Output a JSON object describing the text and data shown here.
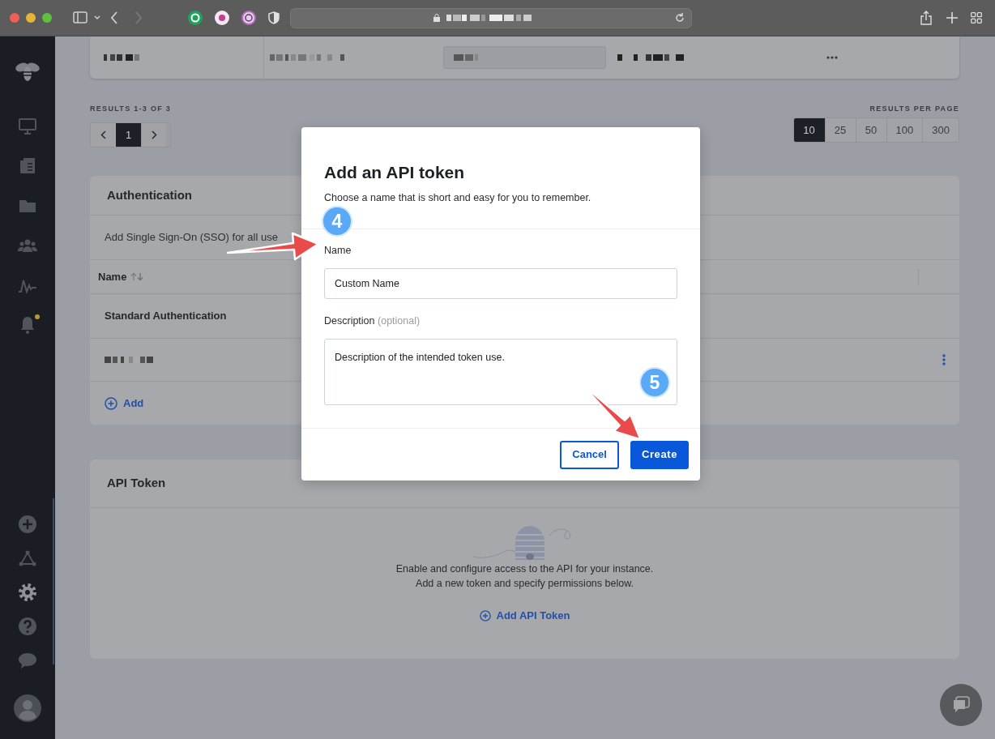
{
  "sidebar": {
    "items": [
      {
        "kind": "monitor",
        "selected": false,
        "notification": false
      },
      {
        "kind": "book",
        "selected": false,
        "notification": false
      },
      {
        "kind": "folder",
        "selected": false,
        "notification": false
      },
      {
        "kind": "users",
        "selected": false,
        "notification": false
      },
      {
        "kind": "pulse",
        "selected": false,
        "notification": false
      },
      {
        "kind": "bell",
        "selected": false,
        "notification": true
      }
    ],
    "bottom_items": [
      {
        "kind": "plus",
        "selected": false
      },
      {
        "kind": "network",
        "selected": false
      },
      {
        "kind": "gear",
        "selected": true
      },
      {
        "kind": "help",
        "selected": false
      },
      {
        "kind": "chat",
        "selected": false
      }
    ]
  },
  "pagination": {
    "results_label": "RESULTS 1-3 OF 3",
    "pages": [
      {
        "label": "1",
        "selected": true
      }
    ],
    "per_page_label": "RESULTS PER PAGE",
    "per_page_options": [
      {
        "label": "10",
        "selected": true
      },
      {
        "label": "25",
        "selected": false
      },
      {
        "label": "50",
        "selected": false
      },
      {
        "label": "100",
        "selected": false
      },
      {
        "label": "300",
        "selected": false
      }
    ]
  },
  "authentication": {
    "title": "Authentication",
    "description": "Add Single Sign-On (SSO) for all use",
    "columns": [
      {
        "label": "Name"
      }
    ],
    "rows": [
      {
        "kind": "group",
        "name": "Standard Authentication"
      },
      {
        "kind": "item"
      }
    ],
    "add_label": "Add"
  },
  "api_token": {
    "title": "API Token",
    "lines": [
      "Enable and configure access to the API for your instance.",
      "Add a new token and specify permissions below."
    ],
    "add_label": "Add API Token"
  },
  "modal": {
    "title": "Add an API token",
    "subtitle": "Choose a name that is short and easy for you to remember.",
    "fields": [
      {
        "kind": "input",
        "label": "Name",
        "value": "Custom Name"
      },
      {
        "kind": "textarea",
        "label": "Description",
        "hint": "(optional)",
        "value": "Description of the intended token use."
      }
    ],
    "buttons": [
      {
        "kind": "secondary",
        "label": "Cancel"
      },
      {
        "kind": "primary",
        "label": "Create"
      }
    ]
  },
  "annotations": [
    {
      "number": "4"
    },
    {
      "number": "5"
    }
  ]
}
